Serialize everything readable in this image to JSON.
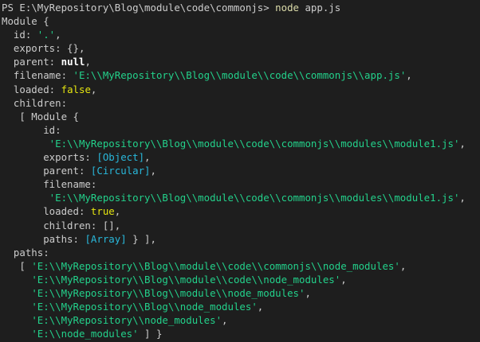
{
  "terminal": {
    "prompt": {
      "path": "PS E:\\MyRepository\\Blog\\module\\code\\commonjs> ",
      "command": "node",
      "argument": " app.js"
    },
    "module": {
      "header": "Module {",
      "id_key": "  id: ",
      "id_value": "'.'",
      "id_end": ",",
      "exports_line": "  exports: {},",
      "parent_key": "  parent: ",
      "parent_value": "null",
      "parent_end": ",",
      "filename_key": "  filename: ",
      "filename_value": "'E:\\\\MyRepository\\\\Blog\\\\module\\\\code\\\\commonjs\\\\app.js'",
      "filename_end": ",",
      "loaded_key": "  loaded: ",
      "loaded_value": "false",
      "loaded_end": ",",
      "children_key": "  children:",
      "child": {
        "header": "   [ Module {",
        "id_key": "       id:",
        "id_value": "        'E:\\\\MyRepository\\\\Blog\\\\module\\\\code\\\\commonjs\\\\modules\\\\module1.js'",
        "id_end": ",",
        "exports_key": "       exports: ",
        "exports_value": "[Object]",
        "exports_end": ",",
        "parent_key": "       parent: ",
        "parent_value": "[Circular]",
        "parent_end": ",",
        "filename_key": "       filename:",
        "filename_value": "        'E:\\\\MyRepository\\\\Blog\\\\module\\\\code\\\\commonjs\\\\modules\\\\module1.js'",
        "filename_end": ",",
        "loaded_key": "       loaded: ",
        "loaded_value": "true",
        "loaded_end": ",",
        "children_line": "       children: [],",
        "paths_key": "       paths: ",
        "paths_value": "[Array]",
        "paths_end": " } ],"
      },
      "paths_key": "  paths:",
      "paths": [
        {
          "prefix": "   [ ",
          "value": "'E:\\\\MyRepository\\\\Blog\\\\module\\\\code\\\\commonjs\\\\node_modules'",
          "suffix": ","
        },
        {
          "prefix": "     ",
          "value": "'E:\\\\MyRepository\\\\Blog\\\\module\\\\code\\\\node_modules'",
          "suffix": ","
        },
        {
          "prefix": "     ",
          "value": "'E:\\\\MyRepository\\\\Blog\\\\module\\\\node_modules'",
          "suffix": ","
        },
        {
          "prefix": "     ",
          "value": "'E:\\\\MyRepository\\\\Blog\\\\node_modules'",
          "suffix": ","
        },
        {
          "prefix": "     ",
          "value": "'E:\\\\MyRepository\\\\node_modules'",
          "suffix": ","
        },
        {
          "prefix": "     ",
          "value": "'E:\\\\node_modules'",
          "suffix": " ] }"
        }
      ]
    },
    "colors": {
      "background": "#1e1e1e",
      "text": "#cccccc",
      "string": "#23d18b",
      "boolean": "#e5e510",
      "reference": "#29b8db",
      "command": "#dcdcaa"
    }
  }
}
